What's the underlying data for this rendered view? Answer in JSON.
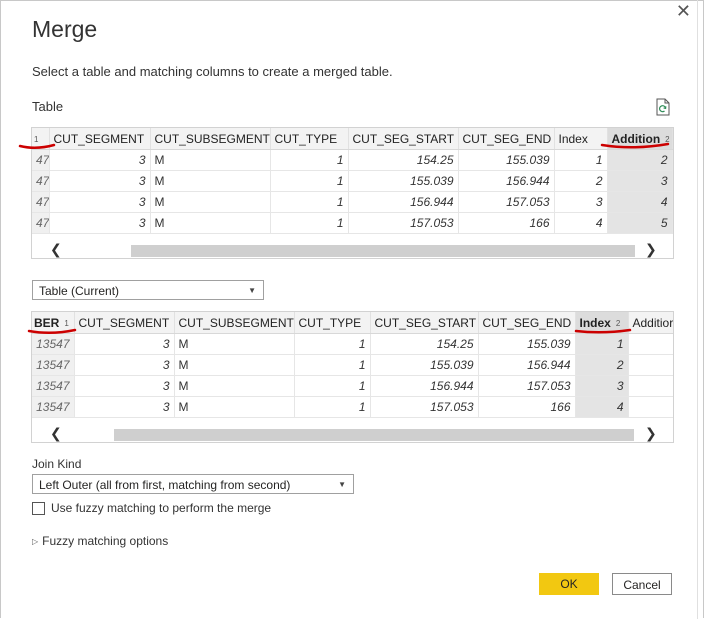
{
  "dialog": {
    "title": "Merge",
    "subtitle": "Select a table and matching columns to create a merged table.",
    "close_glyph": "✕"
  },
  "top_table": {
    "label": "Table",
    "headers": [
      {
        "label": "CUT_SEGMENT"
      },
      {
        "label": "CUT_SUBSEGMENT"
      },
      {
        "label": "CUT_TYPE"
      },
      {
        "label": "CUT_SEG_START"
      },
      {
        "label": "CUT_SEG_END"
      },
      {
        "label": "Index"
      },
      {
        "label": "Addition"
      }
    ],
    "first_col_order": "1",
    "selected_order": "2",
    "rows": [
      [
        "47",
        "3",
        "M",
        "1",
        "154.25",
        "155.039",
        "1",
        "2"
      ],
      [
        "47",
        "3",
        "M",
        "1",
        "155.039",
        "156.944",
        "2",
        "3"
      ],
      [
        "47",
        "3",
        "M",
        "1",
        "156.944",
        "157.053",
        "3",
        "4"
      ],
      [
        "47",
        "3",
        "M",
        "1",
        "157.053",
        "166",
        "4",
        "5"
      ]
    ]
  },
  "table_select": {
    "value": "Table (Current)"
  },
  "bottom_table": {
    "headers": [
      {
        "label": "BER"
      },
      {
        "label": "CUT_SEGMENT"
      },
      {
        "label": "CUT_SUBSEGMENT"
      },
      {
        "label": "CUT_TYPE"
      },
      {
        "label": "CUT_SEG_START"
      },
      {
        "label": "CUT_SEG_END"
      },
      {
        "label": "Index"
      },
      {
        "label": "Additior"
      }
    ],
    "first_col_order": "1",
    "selected_order": "2",
    "rows": [
      [
        "13547",
        "3",
        "M",
        "1",
        "154.25",
        "155.039",
        "1",
        ""
      ],
      [
        "13547",
        "3",
        "M",
        "1",
        "155.039",
        "156.944",
        "2",
        ""
      ],
      [
        "13547",
        "3",
        "M",
        "1",
        "156.944",
        "157.053",
        "3",
        ""
      ],
      [
        "13547",
        "3",
        "M",
        "1",
        "157.053",
        "166",
        "4",
        ""
      ]
    ]
  },
  "join_kind": {
    "label": "Join Kind",
    "value": "Left Outer (all from first, matching from second)"
  },
  "fuzzy_checkbox": {
    "label": "Use fuzzy matching to perform the merge",
    "checked": false
  },
  "fuzzy_options": {
    "label": "Fuzzy matching options"
  },
  "buttons": {
    "ok": "OK",
    "cancel": "Cancel"
  },
  "colors": {
    "ok_button": "#f2c811",
    "annotation_red": "#cc0000"
  }
}
